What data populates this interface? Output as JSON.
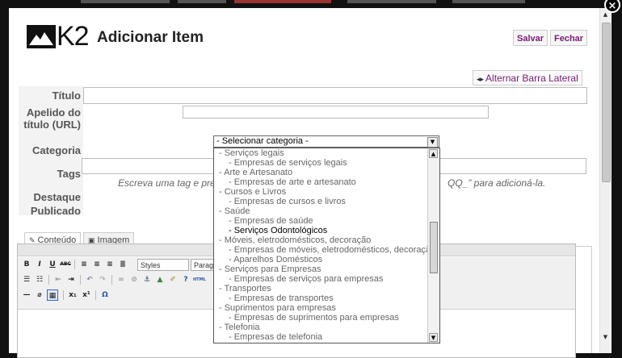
{
  "modal": {
    "logo_text": "K2",
    "title": "Adicionar Item",
    "save_label": "Salvar",
    "close_label": "Fechar",
    "close_icon": "×",
    "toggle_sidebar_label": "Alternar Barra Lateral"
  },
  "form": {
    "title_label": "Título",
    "alias_label": "Apelido do título (URL)",
    "category_label": "Categoria",
    "tags_label": "Tags",
    "featured_label": "Destaque",
    "published_label": "Publicado",
    "tag_hint": "Escreva uma tag e pre",
    "tag_hint_end": "QQ_” para adicioná-la."
  },
  "tabs": [
    {
      "label": "Conteúdo"
    },
    {
      "label": "Imagem"
    }
  ],
  "editor": {
    "styles_value": "Styles",
    "format_value": "Parag"
  },
  "category_select": {
    "selected": "- Selecionar categoria -",
    "options": [
      {
        "label": "- Serviços legais",
        "level": 1,
        "selected": false
      },
      {
        "label": "- Empresas de serviços legais",
        "level": 2,
        "selected": false
      },
      {
        "label": "- Arte e Artesanato",
        "level": 1,
        "selected": false
      },
      {
        "label": "- Empresas de arte e artesanato",
        "level": 2,
        "selected": false
      },
      {
        "label": "- Cursos e Livros",
        "level": 1,
        "selected": false
      },
      {
        "label": "- Empresas de cursos e livros",
        "level": 2,
        "selected": false
      },
      {
        "label": "- Saúde",
        "level": 1,
        "selected": false
      },
      {
        "label": "- Empresas de saúde",
        "level": 2,
        "selected": false
      },
      {
        "label": "- Serviços Odontológicos",
        "level": 2,
        "selected": true
      },
      {
        "label": "- Móveis, eletrodomésticos, decoração",
        "level": 1,
        "selected": false
      },
      {
        "label": "- Empresas de móveis, eletrodomésticos, decoração",
        "level": 2,
        "selected": false
      },
      {
        "label": "- Aparelhos Domésticos",
        "level": 2,
        "selected": false
      },
      {
        "label": "- Serviços para Empresas",
        "level": 1,
        "selected": false
      },
      {
        "label": "- Empresas de serviços para empresas",
        "level": 2,
        "selected": false
      },
      {
        "label": "- Transportes",
        "level": 1,
        "selected": false
      },
      {
        "label": "- Empresas de transportes",
        "level": 2,
        "selected": false
      },
      {
        "label": "- Suprimentos para empresas",
        "level": 1,
        "selected": false
      },
      {
        "label": "- Empresas de suprimentos para empresas",
        "level": 2,
        "selected": false
      },
      {
        "label": "- Telefonia",
        "level": 1,
        "selected": false
      },
      {
        "label": "- Empresas de telefonia",
        "level": 2,
        "selected": false
      }
    ]
  },
  "colors": {
    "accent": "#7a1a77",
    "backdrop": "#111111"
  }
}
